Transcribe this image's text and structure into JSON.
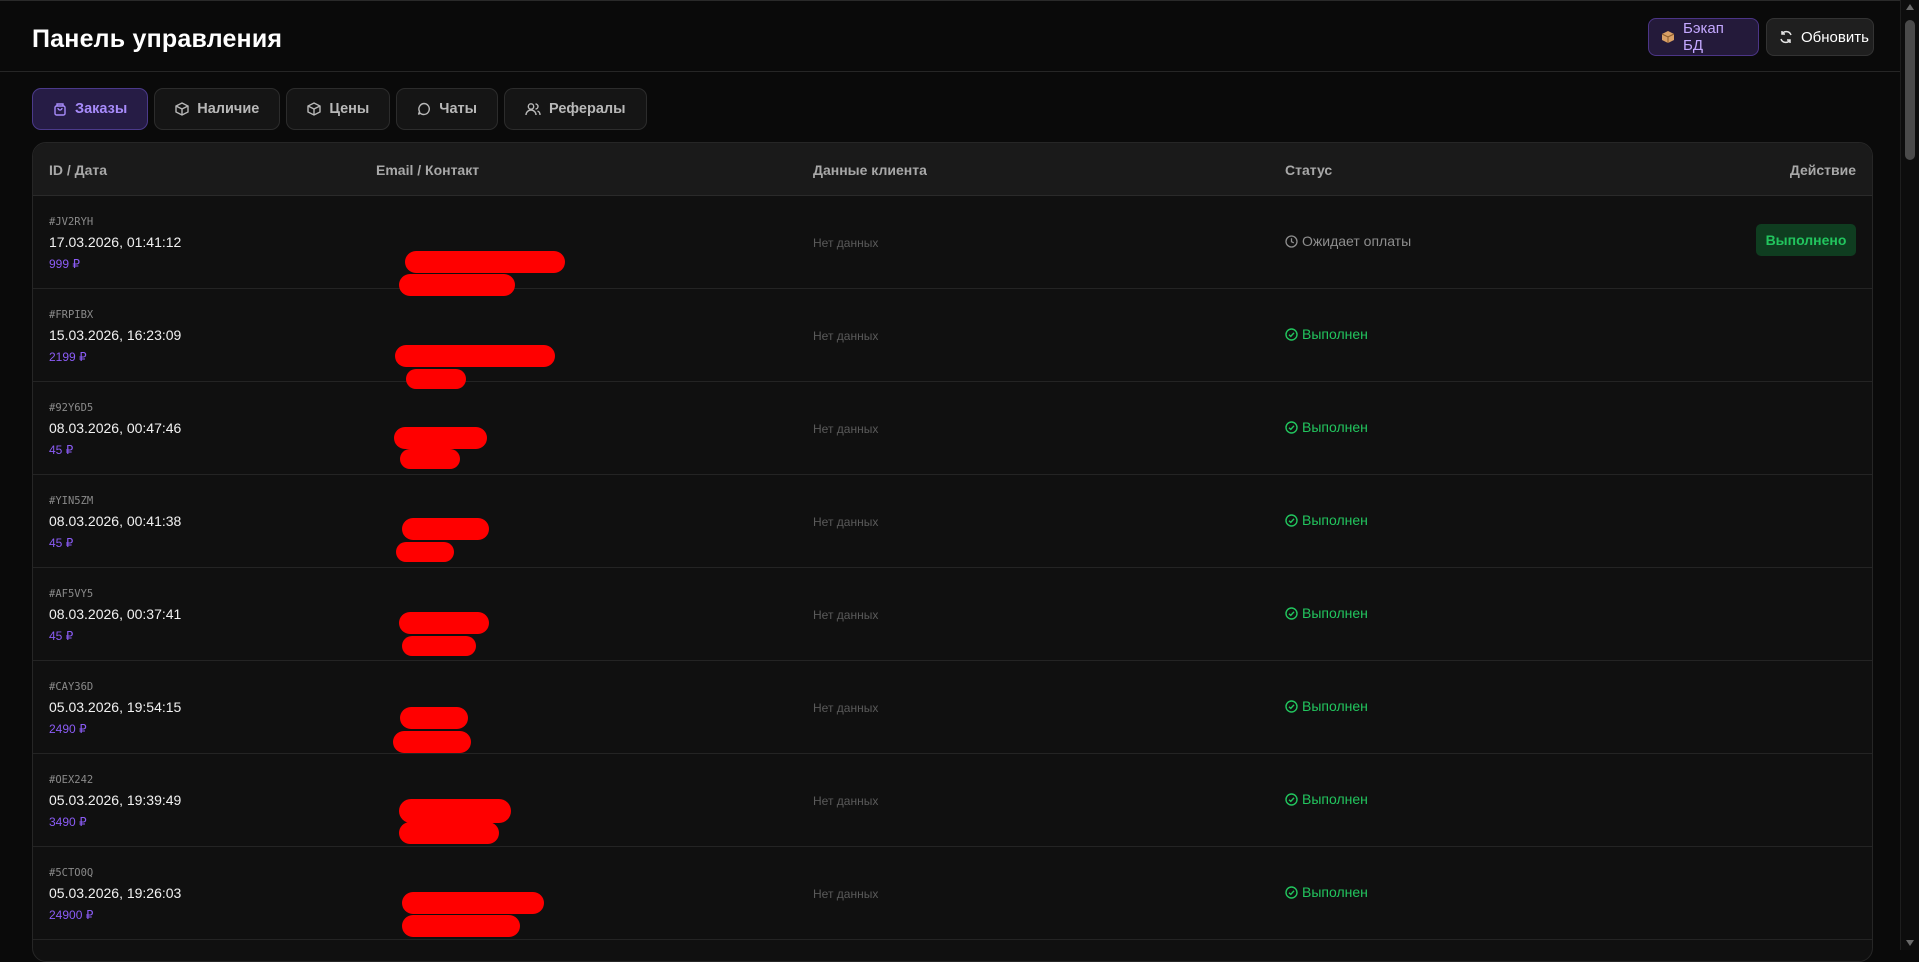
{
  "header": {
    "title": "Панель управления",
    "backup_label": "Бэкап БД",
    "refresh_label": "Обновить"
  },
  "tabs": [
    {
      "label": "Заказы",
      "icon": "shopping-bag-icon",
      "active": true
    },
    {
      "label": "Наличие",
      "icon": "box-icon",
      "active": false
    },
    {
      "label": "Цены",
      "icon": "box-icon",
      "active": false
    },
    {
      "label": "Чаты",
      "icon": "chat-bubble-icon",
      "active": false
    },
    {
      "label": "Рефералы",
      "icon": "users-icon",
      "active": false
    }
  ],
  "table": {
    "columns": [
      "ID / Дата",
      "Email / Контакт",
      "Данные клиента",
      "Статус",
      "Действие"
    ],
    "rows": [
      {
        "id": "#JV2RYH",
        "date": "17.03.2026, 01:41:12",
        "price": "999 ₽",
        "client": "Нет данных",
        "status": "Ожидает оплаты",
        "status_type": "pending",
        "action": "Выполнено"
      },
      {
        "id": "#FRPIBX",
        "date": "15.03.2026, 16:23:09",
        "price": "2199 ₽",
        "client": "Нет данных",
        "status": "Выполнен",
        "status_type": "done",
        "action": ""
      },
      {
        "id": "#92Y6D5",
        "date": "08.03.2026, 00:47:46",
        "price": "45 ₽",
        "client": "Нет данных",
        "status": "Выполнен",
        "status_type": "done",
        "action": ""
      },
      {
        "id": "#YIN5ZM",
        "date": "08.03.2026, 00:41:38",
        "price": "45 ₽",
        "client": "Нет данных",
        "status": "Выполнен",
        "status_type": "done",
        "action": ""
      },
      {
        "id": "#AF5VY5",
        "date": "08.03.2026, 00:37:41",
        "price": "45 ₽",
        "client": "Нет данных",
        "status": "Выполнен",
        "status_type": "done",
        "action": ""
      },
      {
        "id": "#CAY36D",
        "date": "05.03.2026, 19:54:15",
        "price": "2490 ₽",
        "client": "Нет данных",
        "status": "Выполнен",
        "status_type": "done",
        "action": ""
      },
      {
        "id": "#OEX242",
        "date": "05.03.2026, 19:39:49",
        "price": "3490 ₽",
        "client": "Нет данных",
        "status": "Выполнен",
        "status_type": "done",
        "action": ""
      },
      {
        "id": "#5CTO0Q",
        "date": "05.03.2026, 19:26:03",
        "price": "24900 ₽",
        "client": "Нет данных",
        "status": "Выполнен",
        "status_type": "done",
        "action": ""
      }
    ]
  },
  "colors": {
    "accent": "#8b5cf6",
    "success": "#22c55e",
    "redaction": "#ff0000"
  }
}
